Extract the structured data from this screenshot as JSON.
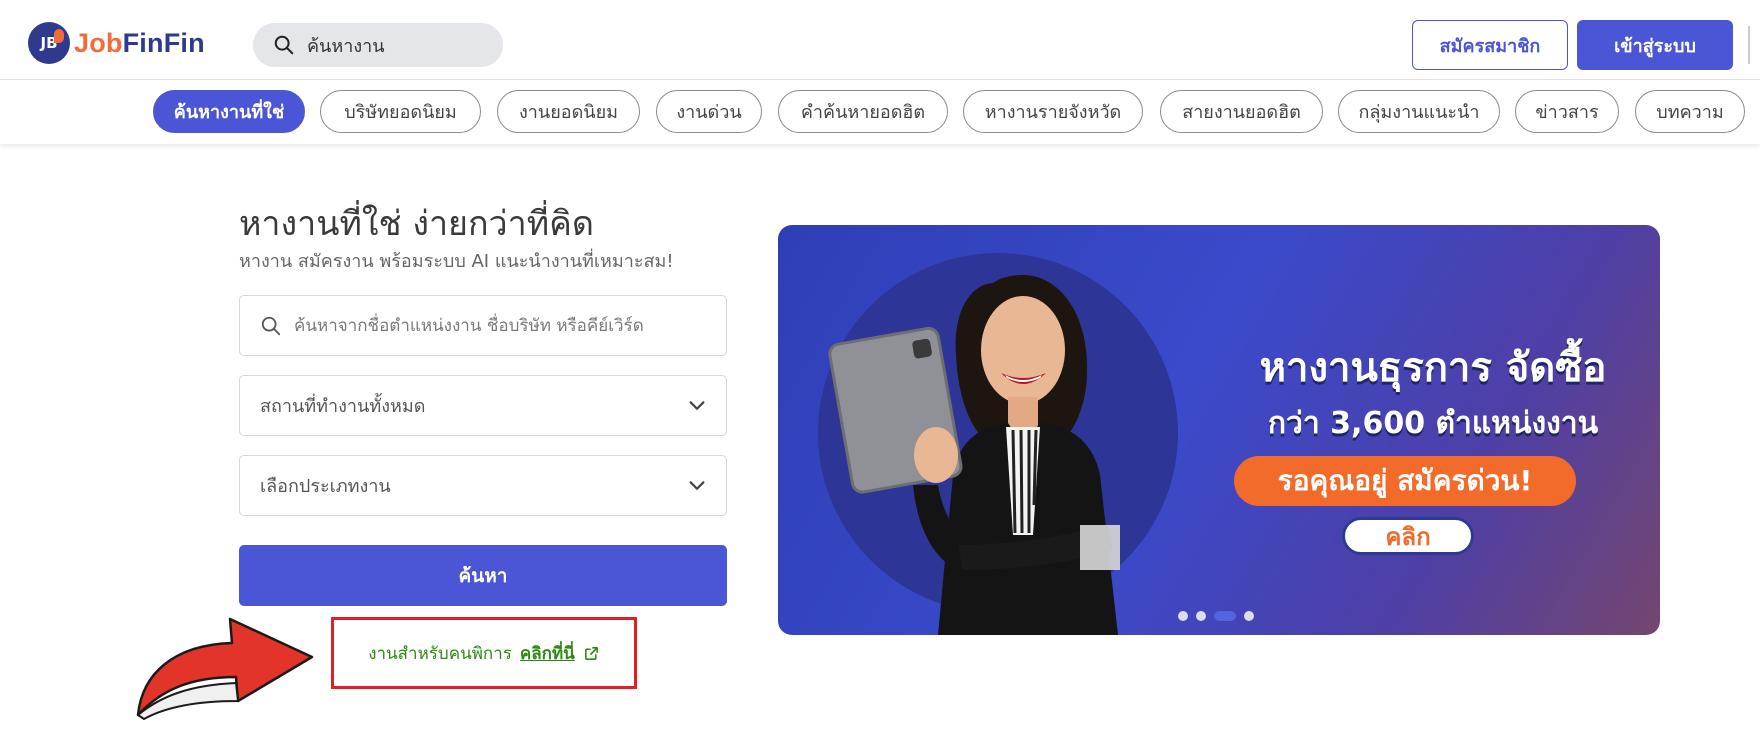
{
  "header": {
    "logo_text_part1": "Job",
    "logo_text_part2": "FinFin",
    "logo_badge": "JB",
    "search_placeholder": "ค้นหางาน",
    "register_label": "สมัครสมาชิก",
    "login_label": "เข้าสู่ระบบ"
  },
  "nav": {
    "items": [
      {
        "label": "ค้นหางานที่ใช่",
        "active": true
      },
      {
        "label": "บริษัทยอดนิยม"
      },
      {
        "label": "งานยอดนิยม"
      },
      {
        "label": "งานด่วน"
      },
      {
        "label": "คำค้นหายอดฮิต"
      },
      {
        "label": "หางานรายจังหวัด"
      },
      {
        "label": "สายงานยอดฮิต"
      },
      {
        "label": "กลุ่มงานแนะนำ"
      },
      {
        "label": "ข่าวสาร"
      },
      {
        "label": "บทความ"
      }
    ]
  },
  "hero": {
    "title": "หางานที่ใช่ ง่ายกว่าที่คิด",
    "subtitle": "หางาน สมัครงาน พร้อมระบบ AI แนะนำงานที่เหมาะสม!",
    "search_placeholder": "ค้นหาจากชื่อตำแหน่งงาน ชื่อบริษัท หรือคีย์เวิร์ด",
    "location_select": "สถานที่ทำงานทั้งหมด",
    "jobtype_select": "เลือกประเภทงาน",
    "search_button": "ค้นหา",
    "disabled_jobs_text": "งานสำหรับคนพิการ",
    "disabled_jobs_link": "คลิกที่นี่"
  },
  "banner": {
    "headline": "หางานธุรการ จัดซื้อ",
    "subheadline": "กว่า 3,600 ตำแหน่งงาน",
    "cta": "รอคุณอยู่ สมัครด่วน!",
    "click_label": "คลิก",
    "dots_total": 4,
    "dot_active_index": 2
  },
  "colors": {
    "primary": "#4a56d6",
    "accent_orange": "#f26b3a",
    "link_green": "#2d8a10",
    "highlight_red": "#e21f26"
  }
}
